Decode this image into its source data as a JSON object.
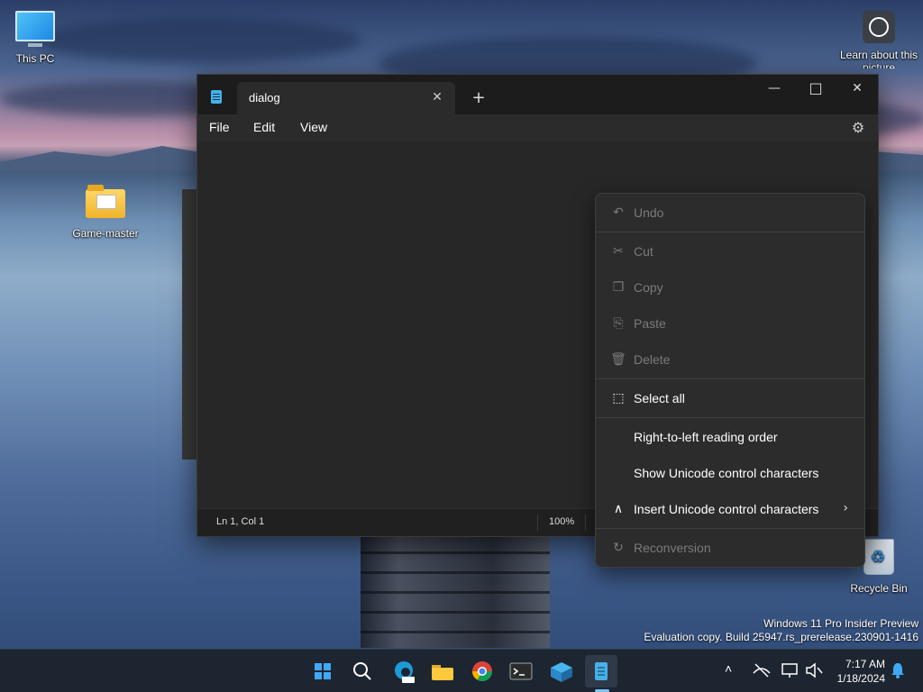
{
  "desktop": {
    "icons": {
      "this_pc": "This PC",
      "game_master": "Game-master",
      "learn_about": "Learn about this picture",
      "recycle_bin": "Recycle Bin"
    },
    "watermark": {
      "line1": "Windows 11 Pro Insider Preview",
      "line2": "Evaluation copy. Build 25947.rs_prerelease.230901-1416"
    }
  },
  "notepad": {
    "tab_title": "dialog",
    "tab_close": "✕",
    "new_tab": "+",
    "minimize": "—",
    "maximize": "□",
    "close": "✕",
    "menu": {
      "file": "File",
      "edit": "Edit",
      "view": "View"
    },
    "settings_icon": "⚙",
    "status": {
      "position": "Ln 1, Col 1",
      "zoom": "100%"
    }
  },
  "context_menu": {
    "undo": "Undo",
    "cut": "Cut",
    "copy": "Copy",
    "paste": "Paste",
    "delete": "Delete",
    "select_all": "Select all",
    "rtl": "Right-to-left reading order",
    "show_unicode": "Show Unicode control characters",
    "insert_unicode": "Insert Unicode control characters",
    "reconversion": "Reconversion",
    "chevron": "›"
  },
  "taskbar": {
    "tray_chevron": "˄",
    "time": "7:17 AM",
    "date": "1/18/2024"
  },
  "colors": {
    "accent": "#3fa9f5",
    "window_bg": "#202020",
    "menu_bg": "#2c2c2c"
  }
}
